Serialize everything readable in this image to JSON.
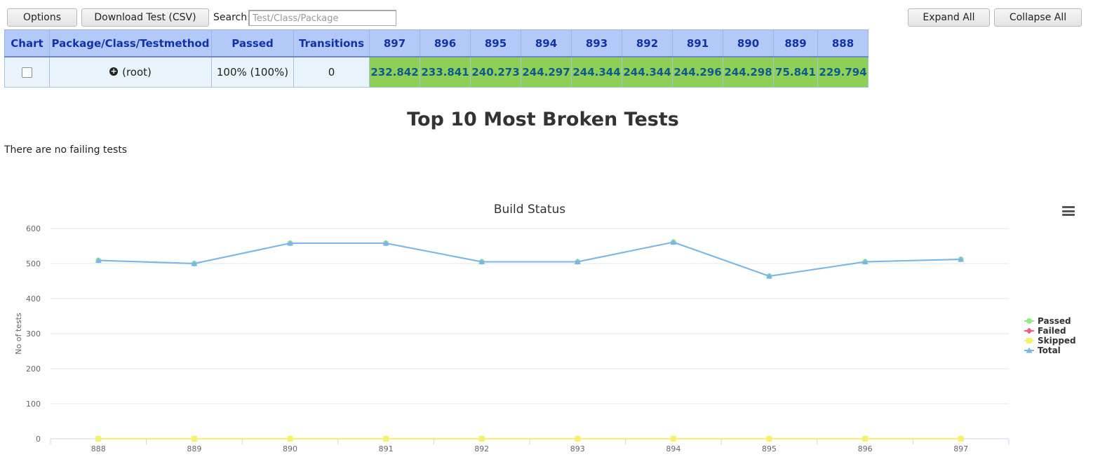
{
  "toolbar": {
    "options_label": "Options",
    "download_label": "Download Test (CSV)",
    "search_label": "Search:",
    "search_placeholder": "Test/Class/Package",
    "expand_all_label": "Expand All",
    "collapse_all_label": "Collapse All"
  },
  "table": {
    "headers": [
      "Chart",
      "Package/Class/Testmethod",
      "Passed",
      "Transitions",
      "897",
      "896",
      "895",
      "894",
      "893",
      "892",
      "891",
      "890",
      "889",
      "888"
    ],
    "row": {
      "package": "(root)",
      "passed": "100% (100%)",
      "transitions": "0",
      "durations": [
        "232.842",
        "233.841",
        "240.273",
        "244.297",
        "244.344",
        "244.344",
        "244.296",
        "244.298",
        "75.841",
        "229.794"
      ]
    }
  },
  "broken": {
    "title": "Top 10 Most Broken Tests",
    "message": "There are no failing tests"
  },
  "colors": {
    "passed": "#90ed7d",
    "failed": "#f15c80",
    "skipped": "#f7f06c",
    "total": "#7cb5ec",
    "header_bg": "#b3c9f8",
    "build_cell_bg": "#8ed055"
  },
  "chart_data": {
    "type": "line",
    "title": "Build Status",
    "xlabel": "",
    "ylabel": "No of tests",
    "categories": [
      "888",
      "889",
      "890",
      "891",
      "892",
      "893",
      "894",
      "895",
      "896",
      "897"
    ],
    "ylim": [
      0,
      600
    ],
    "yticks": [
      0,
      100,
      200,
      300,
      400,
      500,
      600
    ],
    "grid": true,
    "legend": "right",
    "series": [
      {
        "name": "Passed",
        "marker": "circle",
        "values": [
          509,
          500,
          558,
          558,
          505,
          505,
          561,
          464,
          505,
          512
        ]
      },
      {
        "name": "Failed",
        "marker": "diamond",
        "values": [
          0,
          0,
          0,
          0,
          0,
          0,
          0,
          0,
          0,
          0
        ]
      },
      {
        "name": "Skipped",
        "marker": "square",
        "values": [
          0,
          0,
          0,
          0,
          0,
          0,
          0,
          0,
          0,
          0
        ]
      },
      {
        "name": "Total",
        "marker": "triangle",
        "values": [
          509,
          500,
          558,
          558,
          505,
          505,
          561,
          464,
          505,
          512
        ]
      }
    ]
  }
}
